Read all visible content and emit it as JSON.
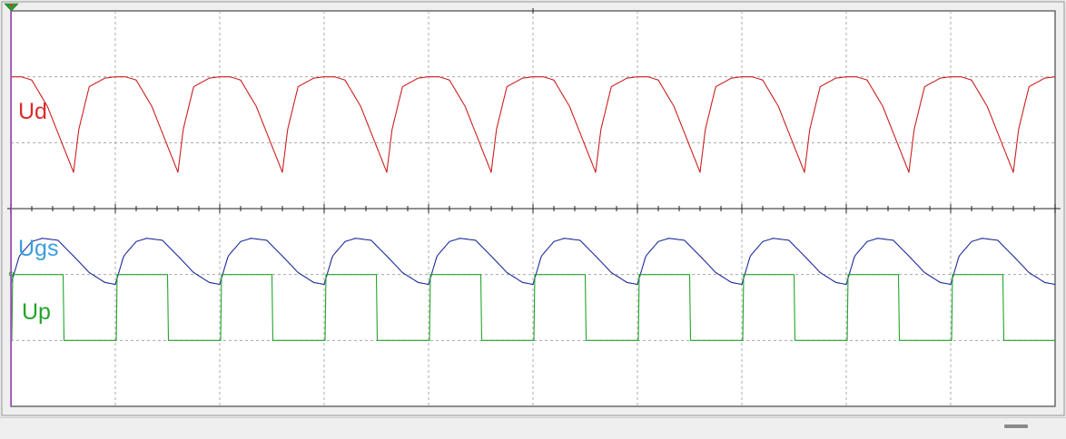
{
  "chart_data": {
    "type": "line",
    "title": "",
    "xlabel": "",
    "ylabel": "",
    "x_divisions": 10,
    "y_divisions": 6,
    "grid": true,
    "series": [
      {
        "name": "Ud",
        "color": "#cc1f1f",
        "y_div_high": 5.0,
        "y_div_low": 3.55,
        "x": [
          0,
          0.1,
          0.2,
          0.35,
          0.5,
          0.55,
          0.6,
          0.65,
          0.75,
          0.9,
          1.0
        ],
        "y": [
          5.0,
          5.0,
          4.95,
          4.55,
          3.95,
          3.75,
          3.55,
          4.2,
          4.85,
          4.98,
          5.0
        ]
      },
      {
        "name": "Ugs",
        "color": "#1c2a9a",
        "y_div_high": 2.55,
        "y_div_low": 1.85,
        "x": [
          0,
          0.08,
          0.2,
          0.3,
          0.45,
          0.6,
          0.75,
          0.9,
          1.0
        ],
        "y": [
          1.85,
          2.28,
          2.5,
          2.55,
          2.52,
          2.28,
          2.03,
          1.88,
          1.85
        ]
      },
      {
        "name": "Up",
        "color": "#22a52a",
        "y_div_high": 2.0,
        "y_div_low": 1.0,
        "duty": 0.5,
        "x": [
          0,
          0.49,
          0.51,
          0.99,
          1.0
        ],
        "y": [
          2.0,
          2.0,
          1.0,
          1.0,
          2.0
        ]
      }
    ],
    "labels": [
      {
        "text": "Ud",
        "color": "#d92b2b"
      },
      {
        "text": "Ugs",
        "color": "#3a9ee0"
      },
      {
        "text": "Up",
        "color": "#22a52a"
      }
    ]
  }
}
